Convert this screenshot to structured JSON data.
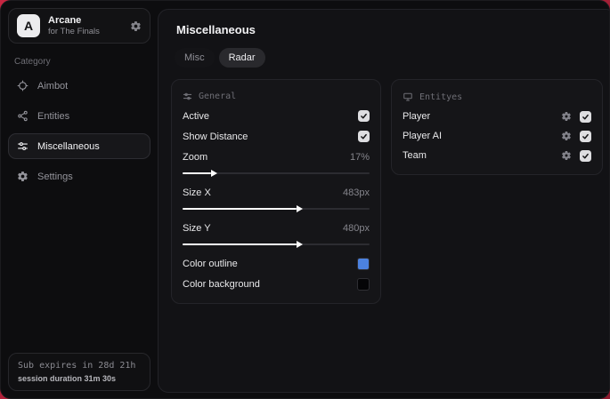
{
  "sidebar": {
    "brand": {
      "name": "Arcane",
      "subtitle": "for The Finals",
      "avatar_letter": "A"
    },
    "category_label": "Category",
    "items": [
      {
        "label": "Aimbot",
        "icon": "crosshair-icon",
        "active": false
      },
      {
        "label": "Entities",
        "icon": "entities-icon",
        "active": false
      },
      {
        "label": "Miscellaneous",
        "icon": "sliders-icon",
        "active": true
      },
      {
        "label": "Settings",
        "icon": "gear-icon",
        "active": false
      }
    ],
    "footer": {
      "subscription": "Sub expires in 28d 21h",
      "session": "session duration 31m 30s"
    }
  },
  "main": {
    "title": "Miscellaneous",
    "tabs": [
      {
        "label": "Misc",
        "active": false
      },
      {
        "label": "Radar",
        "active": true
      }
    ],
    "general_panel": {
      "title": "General",
      "toggles": [
        {
          "label": "Active",
          "checked": true
        },
        {
          "label": "Show Distance",
          "checked": true
        }
      ],
      "sliders": [
        {
          "label": "Zoom",
          "value": "17%",
          "percent": 15
        },
        {
          "label": "Size X",
          "value": "483px",
          "percent": 61
        },
        {
          "label": "Size Y",
          "value": "480px",
          "percent": 61
        }
      ],
      "color_rows": [
        {
          "label": "Color outline",
          "color": "#4c82e0"
        },
        {
          "label": "Color background",
          "color": "#050507"
        }
      ]
    },
    "entities_panel": {
      "title": "Entityes",
      "rows": [
        {
          "label": "Player",
          "checked": true
        },
        {
          "label": "Player AI",
          "checked": true
        },
        {
          "label": "Team",
          "checked": true
        }
      ]
    }
  },
  "colors": {
    "backdrop_red": "#c62641",
    "outline_swatch": "#4c82e0",
    "background_swatch": "#050507",
    "accent_white": "#ffffff"
  }
}
